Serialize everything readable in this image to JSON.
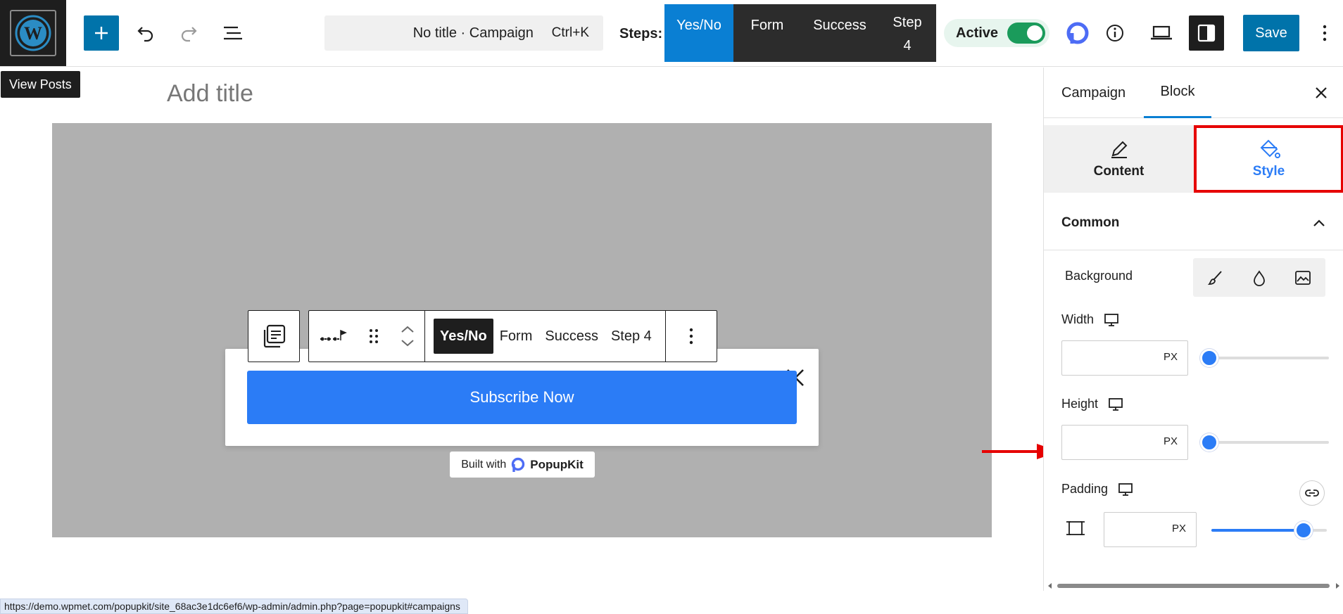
{
  "toolbar": {
    "add_label": "+",
    "search": {
      "title": "No title · Campaign",
      "shortcut": "Ctrl+K"
    },
    "steps_label": "Steps:",
    "steps": [
      {
        "label": "Yes/No",
        "active": true
      },
      {
        "label": "Form",
        "active": false
      },
      {
        "label": "Success",
        "active": false
      },
      {
        "label": "Step\n4",
        "active": false
      }
    ],
    "status": {
      "label": "Active",
      "on": true
    },
    "save_label": "Save"
  },
  "tooltip": "View Posts",
  "canvas": {
    "title_placeholder": "Add title",
    "block_toolbar": {
      "steps": [
        {
          "label": "Yes/No",
          "active": true
        },
        {
          "label": "Form",
          "active": false
        },
        {
          "label": "Success",
          "active": false
        },
        {
          "label": "Step 4",
          "active": false
        }
      ]
    },
    "popup": {
      "button_label": "Subscribe Now",
      "built_with": "Built with",
      "brand": "PopupKit"
    }
  },
  "sidebar": {
    "tabs": [
      {
        "label": "Campaign"
      },
      {
        "label": "Block",
        "active": true
      }
    ],
    "mode_tabs": [
      {
        "label": "Content"
      },
      {
        "label": "Style",
        "active": true
      }
    ],
    "section_title": "Common",
    "background_label": "Background",
    "fields": {
      "width": {
        "label": "Width",
        "unit": "PX",
        "value": "",
        "slider_fraction": 0.0
      },
      "height": {
        "label": "Height",
        "unit": "PX",
        "value": "",
        "slider_fraction": 0.0
      },
      "padding": {
        "label": "Padding",
        "unit": "PX",
        "value": "",
        "slider_fraction": 0.8
      }
    }
  },
  "status_url": "https://demo.wpmet.com/popupkit/site_68ac3e1dc6ef6/wp-admin/admin.php?page=popupkit#campaigns",
  "colors": {
    "accent": "#2b7cf6",
    "wp_blue": "#0073aa",
    "highlight_red": "#e60000",
    "toggle_green": "#1a9b5b"
  }
}
